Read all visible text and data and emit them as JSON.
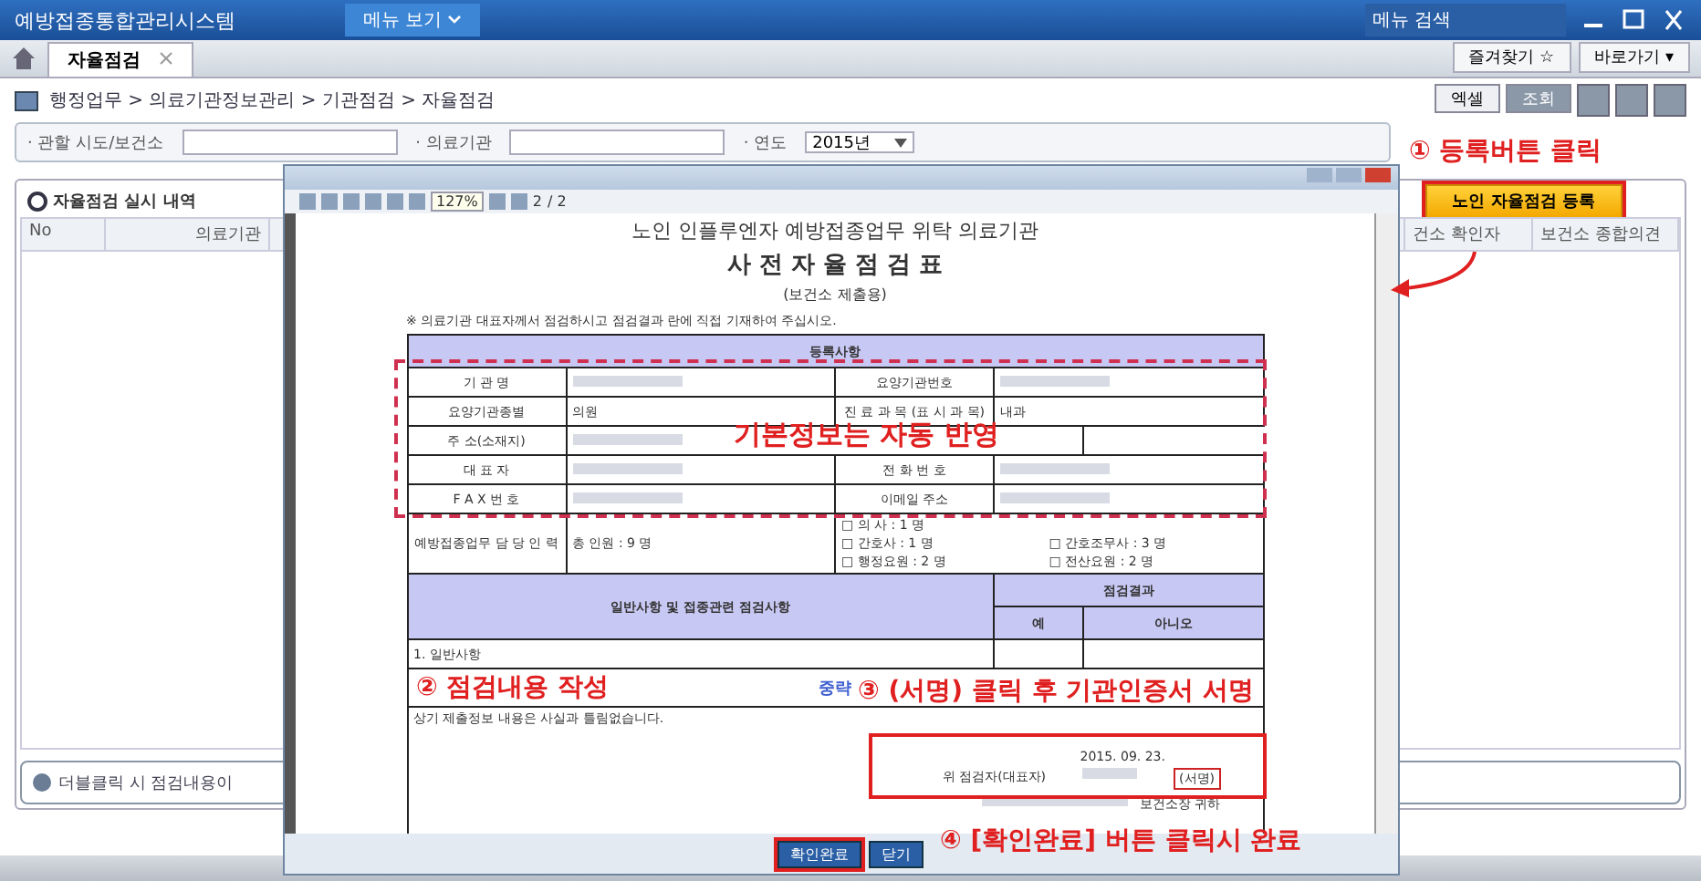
{
  "window": {
    "title": "예방접종통합관리시스템",
    "menu_button": "메뉴 보기",
    "menu_search": "메뉴 검색"
  },
  "tabs": [
    {
      "label": "자율점검",
      "selected": true
    }
  ],
  "top_links": [
    "즐겨찾기 ☆",
    "바로가기 ▾"
  ],
  "breadcrumb": "행정업무 > 의료기관정보관리 > 기관점검 > 자율점검",
  "toolbar_buttons": [
    "엑셀",
    "조회"
  ],
  "filters": [
    {
      "label": "· 관할 시도/보건소"
    },
    {
      "label": "· 의료기관"
    },
    {
      "label": "· 연도",
      "value": "2015년"
    }
  ],
  "panel": {
    "title": "자율점검 실시 내역",
    "register_button": "노인 자율점검 등록",
    "columns": [
      "No",
      "의료기관",
      "건소 확인자",
      "보건소 종합의견"
    ],
    "hint": "더블클릭 시 점검내용이"
  },
  "popup": {
    "zoom": "127%",
    "page": "2",
    "pages": "/ 2",
    "doc": {
      "heading": "노인 인플루엔자 예방접종업무 위탁 의료기관",
      "title": "사 전 자 율 점 검 표",
      "subtitle": "(보건소 제출용)",
      "note": "※ 의료기관 대표자께서 점검하시고 점검결과 란에 직접 기재하여 주십시오.",
      "section": "등록사항",
      "rows": [
        [
          "기 관 명",
          "",
          "요양기관번호",
          ""
        ],
        [
          "요양기관종별",
          "의원",
          "진 료 과 목 (표 시 과 목)",
          "내과"
        ],
        [
          "주 소(소재지)",
          ""
        ],
        [
          "대 표 자",
          "",
          "전 화 번 호",
          ""
        ],
        [
          "F A X 번 호",
          "",
          "이메일 주소",
          ""
        ]
      ],
      "staff_label": "예방접종업무 담 당 인 력",
      "staff_total": "총 인원 : 9 명",
      "staff": [
        "□ 의 사 : 1 명",
        "□ 간호사 : 1 명",
        "□ 간호조무사 : 3 명",
        "□ 행정요원 : 2 명",
        "□ 전산요원 : 2 명"
      ],
      "check_header": "일반사항 및 접종관련 점검사항",
      "result_header": "점검결과",
      "yes": "예",
      "no": "아니오",
      "item": "1. 일반사항",
      "omitted": "중략",
      "statement": "상기 제출정보 내용은 사실과 틀림없습니다.",
      "date": "2015. 09. 23.",
      "signer": "위 점검자(대표자)",
      "sign": "(서명)",
      "addressee": "보건소장 귀하"
    },
    "buttons": [
      "확인완료",
      "닫기"
    ]
  },
  "annotations": [
    {
      "kind": "step",
      "text": "① 등록버튼 클릭"
    },
    {
      "kind": "banner",
      "text": "기본정보는 자동 반영"
    },
    {
      "kind": "step",
      "text": "② 점검내용 작성"
    },
    {
      "kind": "step",
      "text": "③ (서명) 클릭 후 기관인증서 서명"
    },
    {
      "kind": "step",
      "text": "④ [확인완료] 버튼 클릭시 완료"
    }
  ]
}
